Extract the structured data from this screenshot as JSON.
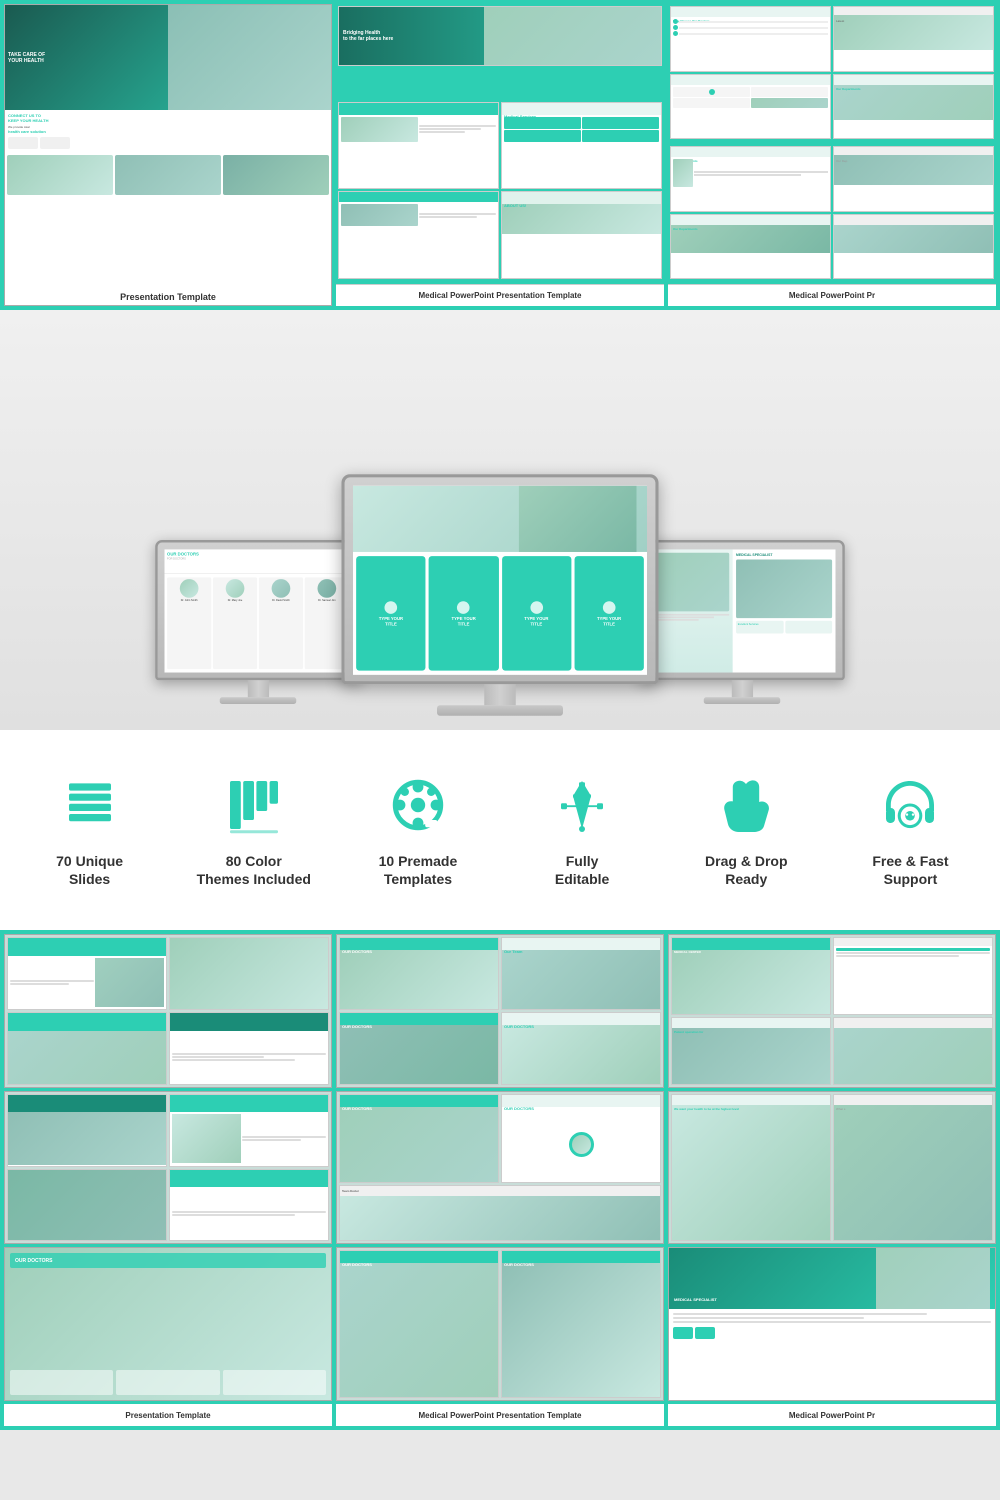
{
  "page": {
    "title": "Medical PowerPoint Presentation Template"
  },
  "top_gallery": {
    "col1_label": "Presentation Template",
    "col2_label": "Medical PowerPoint Presentation Template",
    "col3_label": "Medical PowerPoint Pr"
  },
  "features": [
    {
      "id": "unique-slides",
      "icon": "layers",
      "label": "70 Unique\nSlides",
      "line1": "70 Unique",
      "line2": "Slides"
    },
    {
      "id": "color-themes",
      "icon": "palette",
      "label": "80 Color\nThemes Included",
      "line1": "80 Color",
      "line2": "Themes Included"
    },
    {
      "id": "premade-templates",
      "icon": "template",
      "label": "10 Premade\nTemplates",
      "line1": "10 Premade",
      "line2": "Templates"
    },
    {
      "id": "fully-editable",
      "icon": "edit",
      "label": "Fully\nEditable",
      "line1": "Fully",
      "line2": "Editable"
    },
    {
      "id": "drag-drop",
      "icon": "cursor",
      "label": "Drag & Drop\nReady",
      "line1": "Drag & Drop",
      "line2": "Ready"
    },
    {
      "id": "support",
      "icon": "headset",
      "label": "Free & Fast\nSupport",
      "line1": "Free & Fast",
      "line2": "Support"
    }
  ],
  "bottom_gallery": {
    "col1_label": "Presentation Template",
    "col2_label": "Medical PowerPoint Presentation Template",
    "col3_label": "Medical PowerPoint Pr"
  },
  "bottom_product": {
    "title": "Medical PowerPoint"
  },
  "monitors": {
    "left_screen": "OUR DOCTORS",
    "center_screen": "TYPE YOUR TITLE",
    "right_screen": "MEDICAL SPECIALIST"
  },
  "accent_color": "#2dcfb3"
}
